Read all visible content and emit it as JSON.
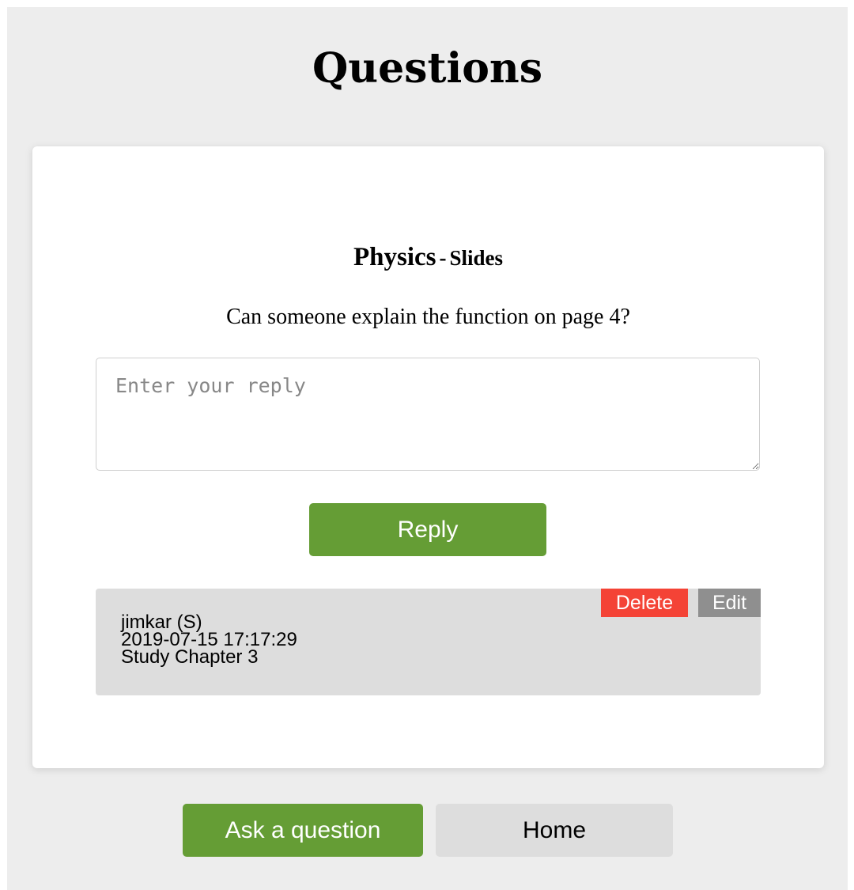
{
  "page": {
    "title": "Questions"
  },
  "question": {
    "course": "Physics",
    "separator": "-",
    "material": "Slides",
    "text": "Can someone explain the function on page 4?"
  },
  "reply_form": {
    "placeholder": "Enter your reply",
    "submit_label": "Reply"
  },
  "answers": [
    {
      "author": "jimkar (S)",
      "timestamp": "2019-07-15 17:17:29",
      "text": "Study Chapter 3",
      "delete_label": "Delete",
      "edit_label": "Edit"
    }
  ],
  "footer": {
    "ask_label": "Ask a question",
    "home_label": "Home"
  },
  "colors": {
    "background": "#ededed",
    "card": "#ffffff",
    "primary_green": "#659d35",
    "delete_red": "#f44336",
    "edit_gray": "#8f8f8f",
    "answer_bg": "#dddddd",
    "home_button_bg": "#dddddd"
  }
}
